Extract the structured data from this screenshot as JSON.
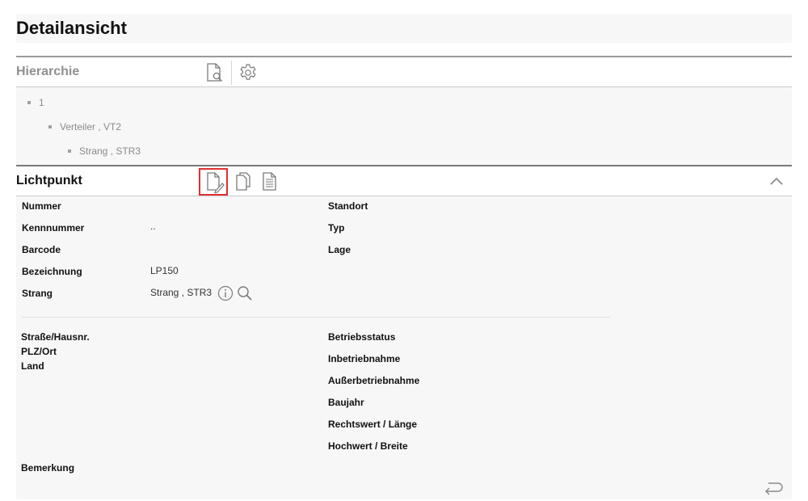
{
  "page": {
    "title": "Detailansicht"
  },
  "hierarchy": {
    "label": "Hierarchie",
    "tree": [
      "1",
      "Verteiler , VT2",
      "Strang , STR3"
    ]
  },
  "lichtpunkt": {
    "label": "Lichtpunkt",
    "left_fields": [
      {
        "label": "Nummer",
        "value": ""
      },
      {
        "label": "Kennnummer",
        "value": ".."
      },
      {
        "label": "Barcode",
        "value": ""
      },
      {
        "label": "Bezeichnung",
        "value": "LP150"
      },
      {
        "label": "Strang",
        "value": "Strang , STR3"
      }
    ],
    "right_fields": [
      {
        "label": "Standort"
      },
      {
        "label": "Typ"
      },
      {
        "label": "Lage"
      }
    ],
    "address_labels": [
      "Straße/Hausnr.",
      "PLZ/Ort",
      "Land"
    ],
    "status_labels": [
      "Betriebsstatus",
      "Inbetriebnahme",
      "Außerbetriebnahme",
      "Baujahr",
      "Rechtswert / Länge",
      "Hochwert / Breite"
    ],
    "remark_label": "Bemerkung"
  },
  "icons": {
    "hierarchy": [
      "document-search-icon",
      "gear-icon"
    ],
    "lichtpunkt": [
      "document-edit-icon",
      "copy-icon",
      "document-text-icon"
    ],
    "strang": [
      "info-icon",
      "search-icon"
    ],
    "collapse": "chevron-up-icon",
    "return": "return-arrow-icon"
  },
  "colors": {
    "highlight": "#e03030",
    "section_border": "#7a7a7a",
    "panel_bg": "#f7f7f7"
  }
}
